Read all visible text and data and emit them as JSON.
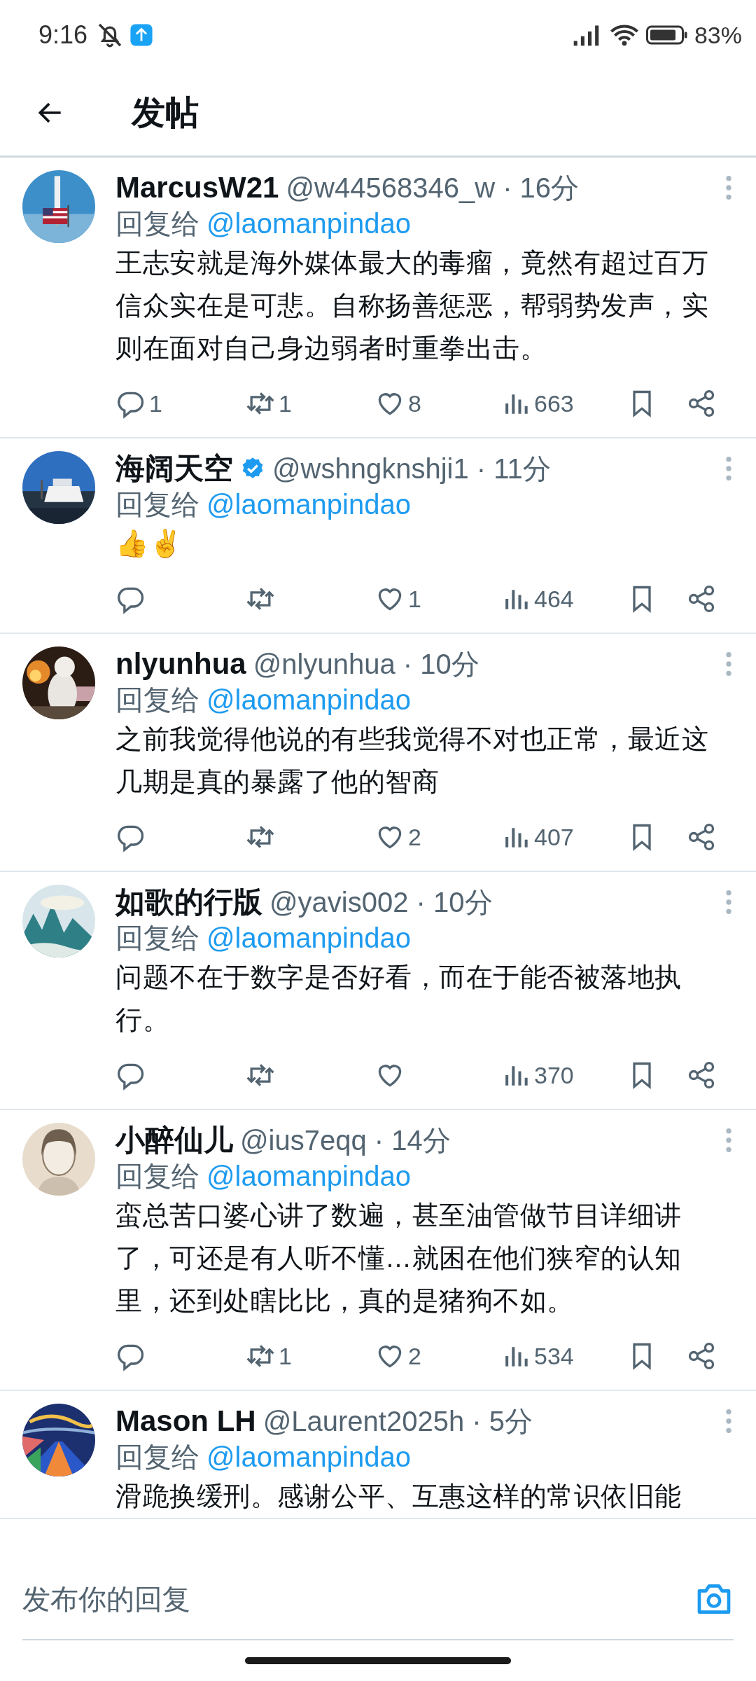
{
  "status_bar": {
    "time": "9:16",
    "battery": "83%"
  },
  "app_bar": {
    "title": "发帖"
  },
  "posts": [
    {
      "name": "MarcusW21",
      "verified": false,
      "meta": "@w44568346_w · 16分",
      "reply_label": "回复给",
      "reply_to": "@laomanpindao",
      "body": "王志安就是海外媒体最大的毒瘤，竟然有超过百万信众实在是可悲。自称扬善惩恶，帮弱势发声，实则在面对自己身边弱者时重拳出击。",
      "actions": {
        "replies": "1",
        "reposts": "1",
        "likes": "8",
        "views": "663"
      }
    },
    {
      "name": "海阔天空",
      "verified": true,
      "meta": "@wshngknshji1 · 11分",
      "reply_label": "回复给",
      "reply_to": "@laomanpindao",
      "body": "👍✌️",
      "actions": {
        "likes": "1",
        "views": "464"
      }
    },
    {
      "name": "nlyunhua",
      "verified": false,
      "meta": "@nlyunhua · 10分",
      "reply_label": "回复给",
      "reply_to": "@laomanpindao",
      "body": "之前我觉得他说的有些我觉得不对也正常，最近这几期是真的暴露了他的智商",
      "actions": {
        "likes": "2",
        "views": "407"
      }
    },
    {
      "name": "如歌的行版",
      "verified": false,
      "meta": "@yavis002 · 10分",
      "reply_label": "回复给",
      "reply_to": "@laomanpindao",
      "body": "问题不在于数字是否好看，而在于能否被落地执行。",
      "actions": {
        "views": "370"
      }
    },
    {
      "name": "小醉仙儿",
      "verified": false,
      "meta": "@ius7eqq · 14分",
      "reply_label": "回复给",
      "reply_to": "@laomanpindao",
      "body": "蛮总苦口婆心讲了数遍，甚至油管做节目详细讲了，可还是有人听不懂…就困在他们狭窄的认知里，还到处瞎比比，真的是猪狗不如。",
      "actions": {
        "reposts": "1",
        "likes": "2",
        "views": "534"
      }
    },
    {
      "name": "Mason LH",
      "verified": false,
      "meta": "@Laurent2025h · 5分",
      "reply_label": "回复给",
      "reply_to": "@laomanpindao",
      "body": "滑跪换缓刑。感谢公平、互惠这样的常识依旧能"
    }
  ],
  "reply_bar": {
    "placeholder": "发布你的回复"
  }
}
